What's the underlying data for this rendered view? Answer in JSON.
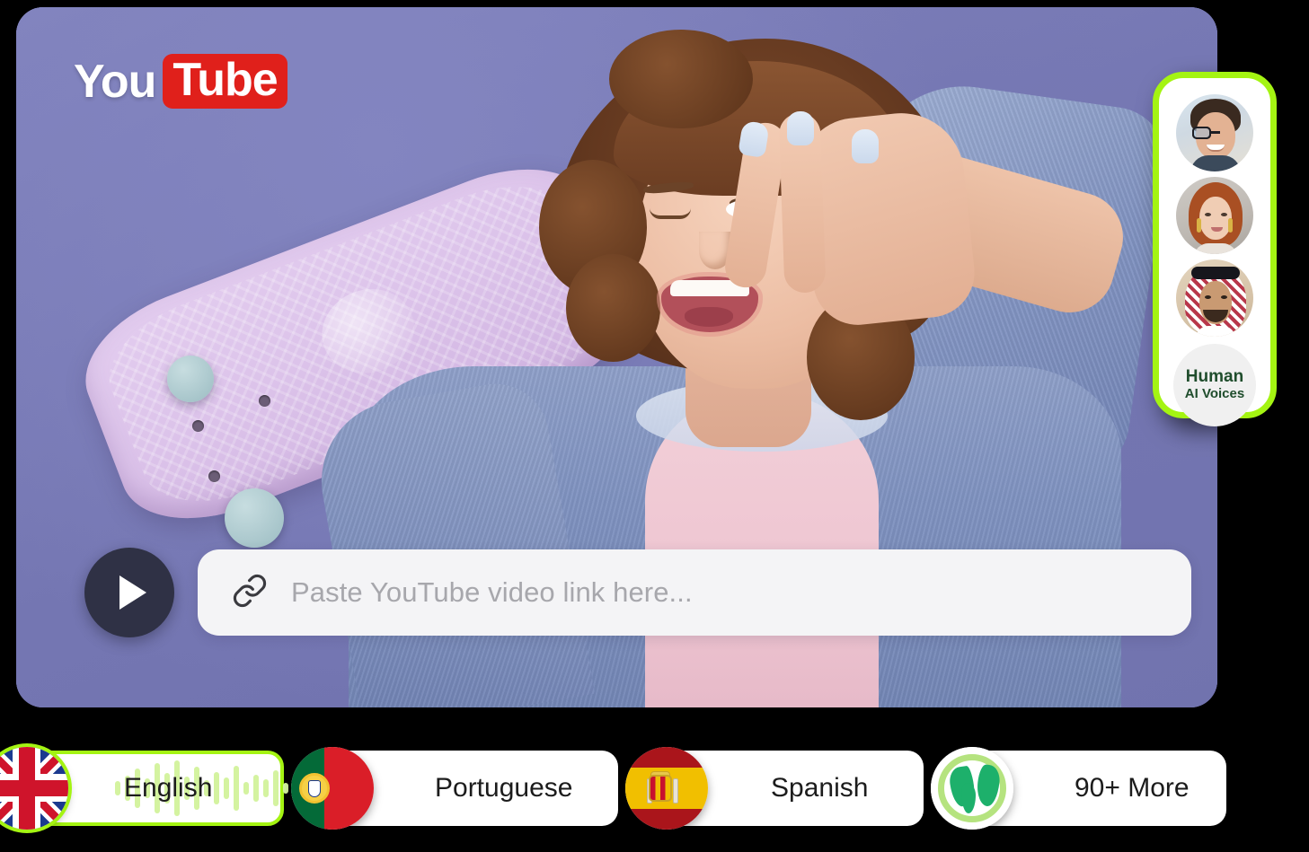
{
  "brand": {
    "logo_you": "You",
    "logo_tube": "Tube",
    "logo_red": "#e0201b"
  },
  "player": {
    "play_icon": "play-triangle-icon",
    "play_button_color": "#2f3145"
  },
  "url_input": {
    "icon": "link-icon",
    "placeholder": "Paste YouTube video link here...",
    "value": ""
  },
  "voices_panel": {
    "border_color": "#a4f412",
    "avatars": [
      {
        "name": "avatar-man-glasses"
      },
      {
        "name": "avatar-woman-redhair"
      },
      {
        "name": "avatar-man-keffiyeh"
      }
    ],
    "badge": {
      "line1": "Human",
      "line2": "AI Voices",
      "text_color": "#1f4d2c"
    }
  },
  "languages": [
    {
      "label": "English",
      "flag": "flag-united-kingdom",
      "selected": true,
      "waveform": true
    },
    {
      "label": "Portuguese",
      "flag": "flag-portugal",
      "selected": false,
      "waveform": false
    },
    {
      "label": "Spanish",
      "flag": "flag-spain",
      "selected": false,
      "waveform": false
    },
    {
      "label": "90+ More",
      "flag": "globe-icon",
      "selected": false,
      "waveform": false
    }
  ],
  "colors": {
    "accent_green": "#a4f412",
    "card_background": "#7b7bb8",
    "input_background": "#f4f4f6",
    "placeholder_text": "#a7a7ac"
  }
}
